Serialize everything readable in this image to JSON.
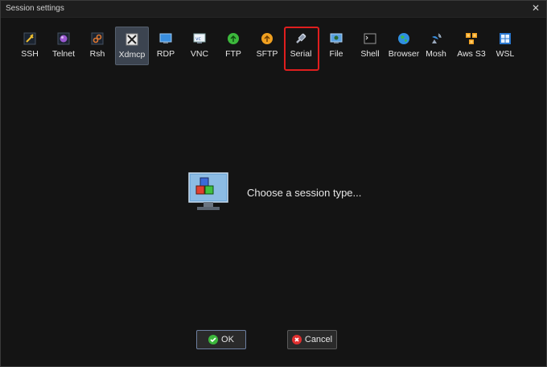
{
  "window": {
    "title": "Session settings"
  },
  "toolbar": {
    "items": [
      {
        "label": "SSH",
        "icon": "ssh-icon"
      },
      {
        "label": "Telnet",
        "icon": "telnet-icon"
      },
      {
        "label": "Rsh",
        "icon": "rsh-icon"
      },
      {
        "label": "Xdmcp",
        "icon": "xdmcp-icon"
      },
      {
        "label": "RDP",
        "icon": "rdp-icon"
      },
      {
        "label": "VNC",
        "icon": "vnc-icon"
      },
      {
        "label": "FTP",
        "icon": "ftp-icon"
      },
      {
        "label": "SFTP",
        "icon": "sftp-icon"
      },
      {
        "label": "Serial",
        "icon": "serial-icon"
      },
      {
        "label": "File",
        "icon": "file-icon"
      },
      {
        "label": "Shell",
        "icon": "shell-icon"
      },
      {
        "label": "Browser",
        "icon": "browser-icon"
      },
      {
        "label": "Mosh",
        "icon": "mosh-icon"
      },
      {
        "label": "Aws S3",
        "icon": "aws-s3-icon"
      },
      {
        "label": "WSL",
        "icon": "wsl-icon"
      }
    ],
    "active": "Xdmcp",
    "highlighted": "Serial"
  },
  "main": {
    "message": "Choose a session type..."
  },
  "buttons": {
    "ok_label": "OK",
    "cancel_label": "Cancel"
  },
  "colors": {
    "highlight": "#e01e1e",
    "accent": "#6d7fa0"
  }
}
